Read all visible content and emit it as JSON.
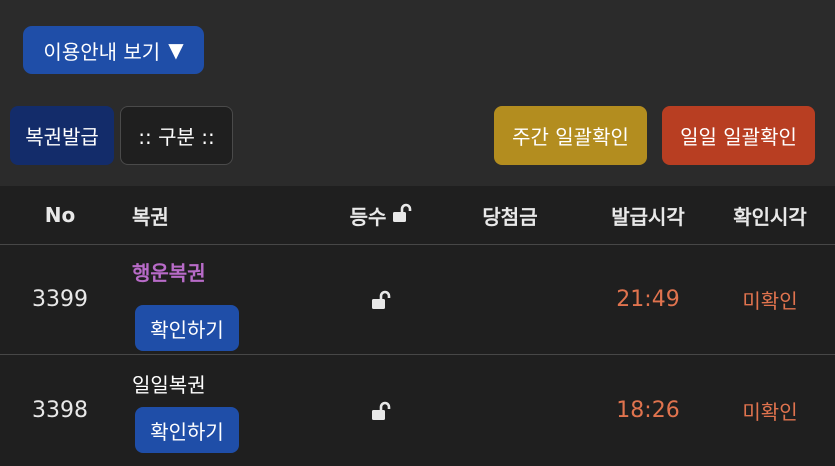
{
  "toolbar": {
    "guide_label": "이용안내 보기",
    "guide_arrow": "▼",
    "issue_label": "복권발급",
    "sort_label": ":: 구분 ::",
    "weekly_label": "주간 일괄확인",
    "daily_label": "일일 일괄확인"
  },
  "table": {
    "headers": {
      "no": "No",
      "ticket": "복권",
      "grade": "등수",
      "prize": "당첨금",
      "issued_time": "발급시각",
      "checked_time": "확인시각"
    },
    "rows": [
      {
        "no": "3399",
        "ticket": "행운복권",
        "confirm_label": "확인하기",
        "prize": "",
        "issued_time": "21:49",
        "status": "미확인"
      },
      {
        "no": "3398",
        "ticket": "일일복권",
        "confirm_label": "확인하기",
        "prize": "",
        "issued_time": "18:26",
        "status": "미확인"
      }
    ]
  },
  "icons": {
    "grade_header": "unlock-icon",
    "row_grade": "unlock-icon"
  },
  "colors": {
    "background": "#2b2b2b",
    "table_bg": "#1f1f1f",
    "primary_blue": "#1f4ea8",
    "dark_blue": "#132c6a",
    "weekly_gold": "#b38d1f",
    "daily_red": "#b83e22",
    "lucky_purple": "#b86bc8",
    "orange_text": "#e0734e"
  }
}
